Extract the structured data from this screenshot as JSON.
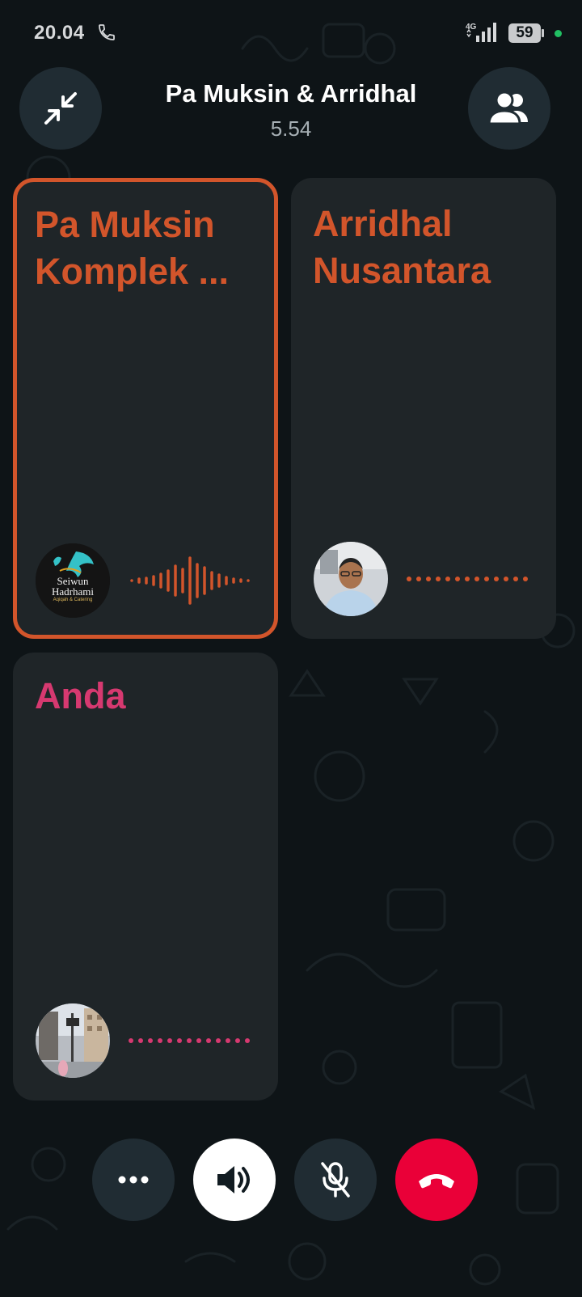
{
  "status_bar": {
    "time": "20.04",
    "network": "4G",
    "battery": "59"
  },
  "header": {
    "title": "Pa Muksin & Arridhal",
    "timer": "5.54"
  },
  "participants": [
    {
      "name": "Pa Muksin Komplek ...",
      "line1": "Pa Muksin",
      "line2": "Komplek ...",
      "speaking": true,
      "avatar_text_1": "Seiwun",
      "avatar_text_2": "Hadrhami",
      "avatar_text_3": "Aqiqah & Catering"
    },
    {
      "name": "Arridhal Nusantara",
      "line1": "Arridhal",
      "line2": "Nusantara",
      "speaking": false
    },
    {
      "name": "Anda",
      "line1": "Anda",
      "speaking": false
    }
  ],
  "controls": {
    "more": "more-options",
    "speaker": "speaker-on",
    "mic": "mic-muted",
    "end": "end-call"
  },
  "colors": {
    "accent_orange": "#d2552b",
    "accent_pink": "#d63970",
    "end_call_red": "#ea0038",
    "tile_bg": "#1f2528",
    "button_bg": "#202c33"
  }
}
